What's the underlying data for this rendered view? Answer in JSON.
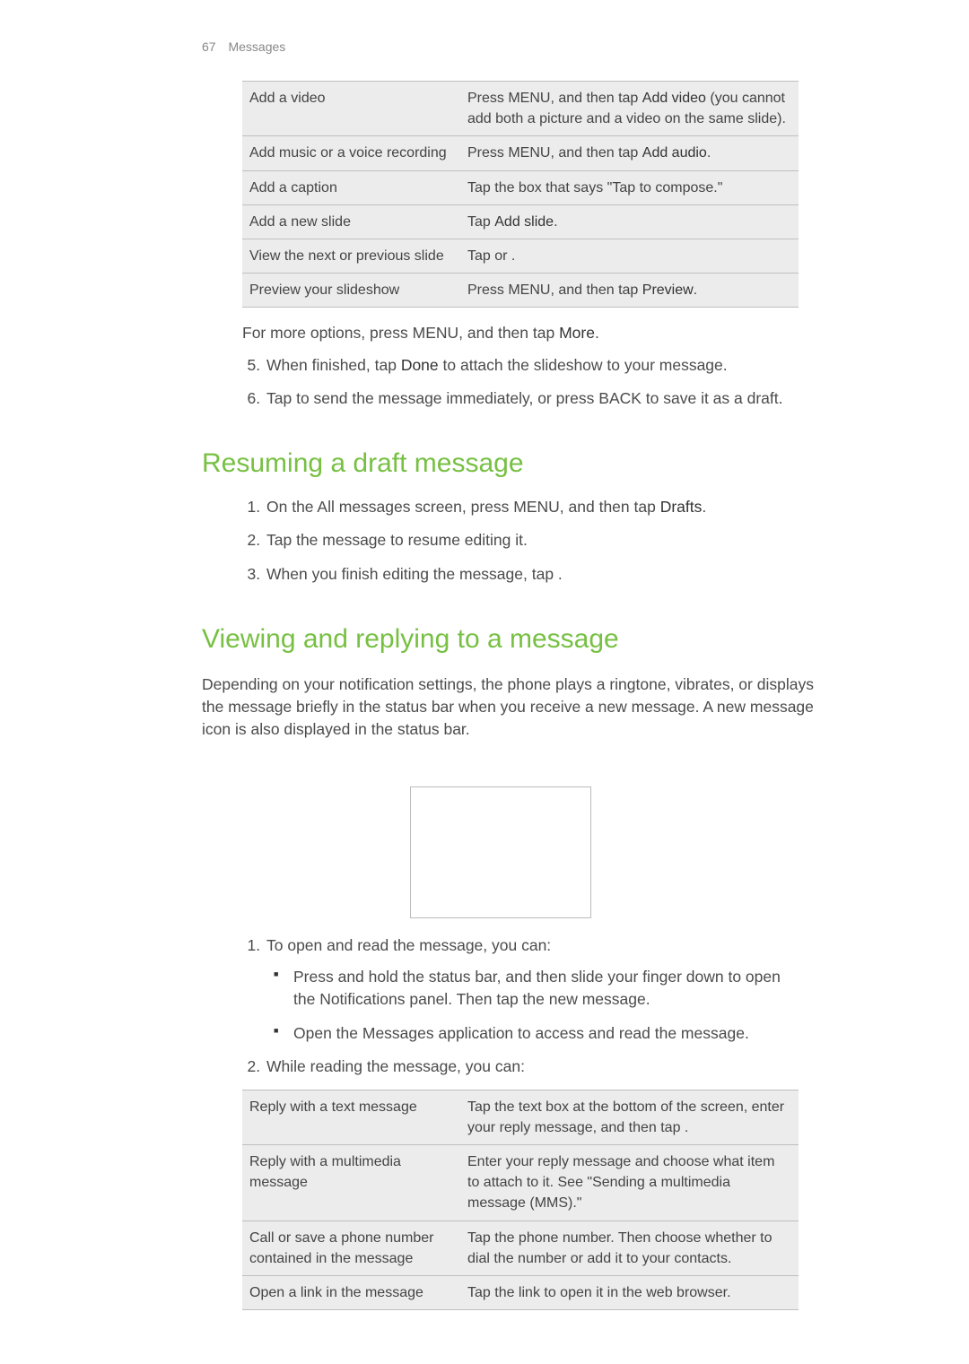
{
  "header": {
    "page_number": "67",
    "section": "Messages"
  },
  "table1": {
    "rows": [
      {
        "left": "Add a video",
        "right_pre": "Press MENU, and then tap ",
        "right_strong": "Add video",
        "right_post": " (you cannot add both a picture and a video on the same slide)."
      },
      {
        "left": "Add music or a voice recording",
        "right_pre": "Press MENU, and then tap ",
        "right_strong": "Add audio",
        "right_post": "."
      },
      {
        "left": "Add a caption",
        "right_pre": "Tap the box that says \"Tap to compose.\"",
        "right_strong": "",
        "right_post": ""
      },
      {
        "left": "Add a new slide",
        "right_pre": "Tap ",
        "right_strong": "Add slide",
        "right_post": "."
      },
      {
        "left": "View the next or previous slide",
        "right_pre": "Tap     or    .",
        "right_strong": "",
        "right_post": ""
      },
      {
        "left": "Preview your slideshow",
        "right_pre": "Press MENU, and then tap ",
        "right_strong": "Preview",
        "right_post": "."
      }
    ]
  },
  "after_table_para": {
    "pre": "For more options, press MENU, and then tap ",
    "strong": "More",
    "post": "."
  },
  "steps_after_table": {
    "s5_pre": "When finished, tap ",
    "s5_strong": "Done",
    "s5_post": " to attach the slideshow to your message.",
    "s6": "Tap       to send the message immediately, or press BACK to save it as a draft."
  },
  "heading1": "Resuming a draft message",
  "resume_steps": {
    "s1_pre": "On the All messages screen, press MENU, and then tap ",
    "s1_strong": "Drafts",
    "s1_post": ".",
    "s2": "Tap the message to resume editing it.",
    "s3": "When you finish editing the message, tap       ."
  },
  "heading2": "Viewing and replying to a message",
  "view_intro": "Depending on your notification settings, the phone plays a ringtone, vibrates, or displays the message briefly in the status bar when you receive a new message. A new message icon        is also displayed in the status bar.",
  "view_steps": {
    "s1": "To open and read the message, you can:",
    "s1_b1": "Press and hold the status bar, and then slide your finger down to open the Notifications panel. Then tap the new message.",
    "s1_b2": "Open the Messages application to access and read the message.",
    "s2": "While reading the message, you can:"
  },
  "table2": {
    "rows": [
      {
        "left": "Reply with a text message",
        "right": "Tap the text box at the bottom of the screen, enter your reply message, and then tap       ."
      },
      {
        "left": "Reply with a multimedia message",
        "right": "Enter your reply message and choose what item to attach to it. See \"Sending a multimedia message (MMS).\""
      },
      {
        "left": "Call or save a phone number contained in the message",
        "right": "Tap the phone number. Then choose whether to dial the number or add it to your contacts."
      },
      {
        "left": "Open a link in the message",
        "right": "Tap the link to open it in the web browser."
      }
    ]
  }
}
